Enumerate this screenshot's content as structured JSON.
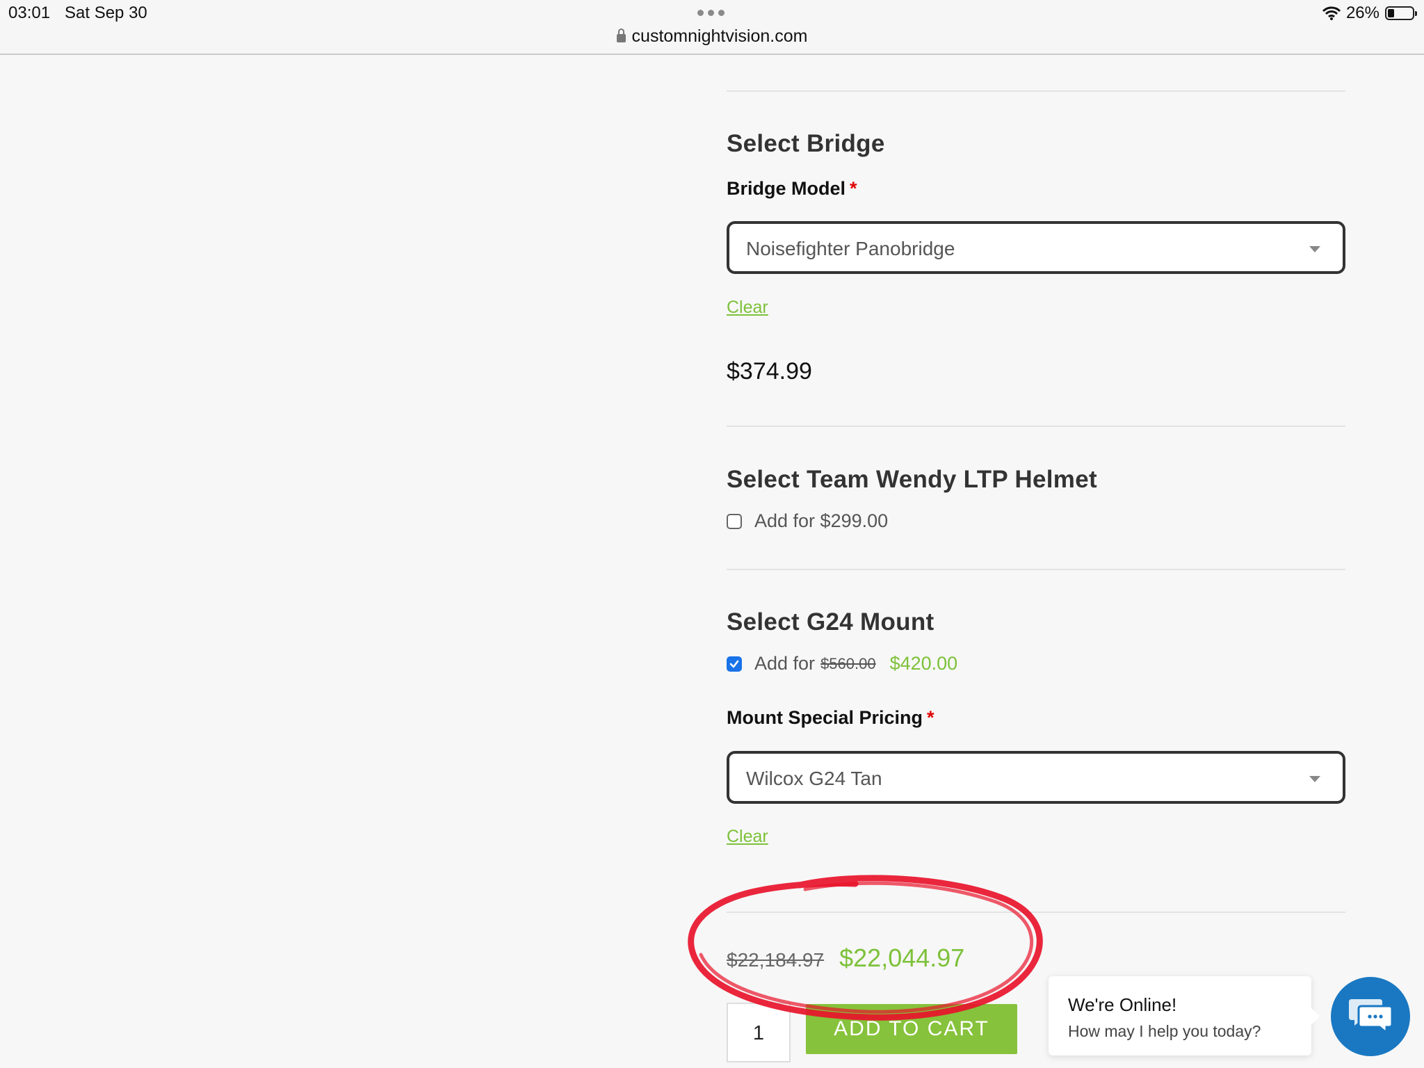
{
  "status_bar": {
    "time": "03:01",
    "date": "Sat Sep 30",
    "url": "customnightvision.com",
    "battery": "26%"
  },
  "bridge_section": {
    "title": "Select Bridge",
    "field_label": "Bridge Model",
    "required_mark": "*",
    "selected_value": "Noisefighter Panobridge",
    "clear_label": "Clear",
    "price": "$374.99"
  },
  "helmet_section": {
    "title": "Select Team Wendy LTP Helmet",
    "checked": false,
    "add_label": "Add for $299.00"
  },
  "mount_section": {
    "title": "Select G24 Mount",
    "checked": true,
    "add_prefix": "Add for",
    "original_price": "$560.00",
    "sale_price": "$420.00",
    "field_label": "Mount Special Pricing",
    "required_mark": "*",
    "selected_value": "Wilcox G24 Tan",
    "clear_label": "Clear"
  },
  "totals": {
    "original_total": "$22,184.97",
    "sale_total": "$22,044.97"
  },
  "cart": {
    "quantity": "1",
    "add_to_cart_label": "ADD TO CART"
  },
  "chat": {
    "title": "We're Online!",
    "subtitle": "How may I help you today?"
  },
  "colors": {
    "accent_green": "#7dc13a",
    "button_green": "#86c23b",
    "chat_blue": "#1a78c2",
    "required_red": "#e00000",
    "annotation_red": "#e8142b"
  }
}
